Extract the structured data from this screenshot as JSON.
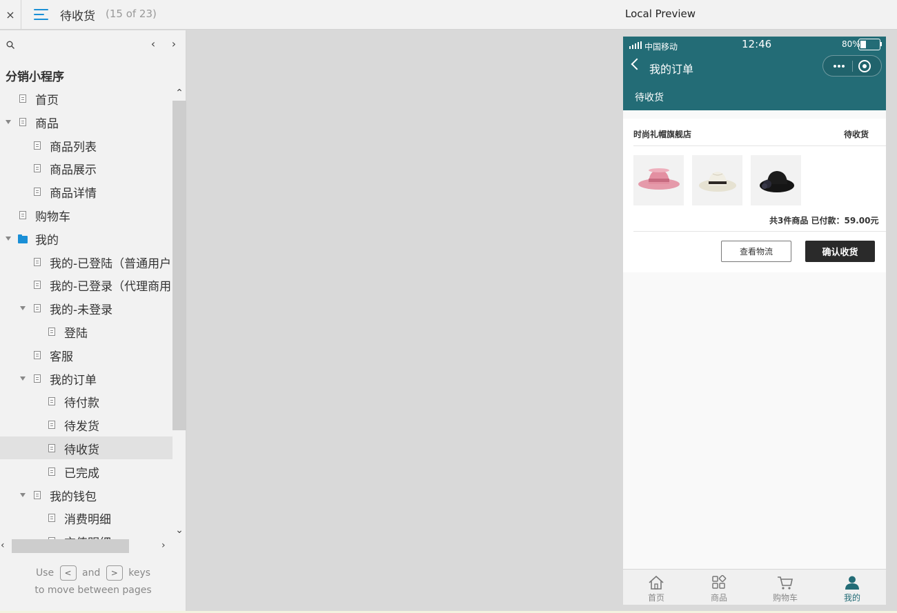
{
  "topbar": {
    "close_icon": "×",
    "page_title": "待收货",
    "page_count": "(15 of 23)",
    "preview_title": "Local Preview"
  },
  "sidebar": {
    "project_title": "分销小程序",
    "tree": [
      {
        "label": "首页",
        "icon": "page",
        "depth": 0
      },
      {
        "label": "商品",
        "icon": "page",
        "depth": 0,
        "expanded": true
      },
      {
        "label": "商品列表",
        "icon": "page",
        "depth": 1
      },
      {
        "label": "商品展示",
        "icon": "page",
        "depth": 1
      },
      {
        "label": "商品详情",
        "icon": "page",
        "depth": 1
      },
      {
        "label": "购物车",
        "icon": "page",
        "depth": 0
      },
      {
        "label": "我的",
        "icon": "folder",
        "depth": 0,
        "expanded": true
      },
      {
        "label": "我的-已登陆（普通用户",
        "icon": "page",
        "depth": 1
      },
      {
        "label": "我的-已登录（代理商用",
        "icon": "page",
        "depth": 1
      },
      {
        "label": "我的-未登录",
        "icon": "page",
        "depth": 1,
        "expanded": true
      },
      {
        "label": "登陆",
        "icon": "page",
        "depth": 2
      },
      {
        "label": "客服",
        "icon": "page",
        "depth": 1
      },
      {
        "label": "我的订单",
        "icon": "page",
        "depth": 1,
        "expanded": true
      },
      {
        "label": "待付款",
        "icon": "page",
        "depth": 2
      },
      {
        "label": "待发货",
        "icon": "page",
        "depth": 2
      },
      {
        "label": "待收货",
        "icon": "page",
        "depth": 2,
        "selected": true
      },
      {
        "label": "已完成",
        "icon": "page",
        "depth": 2
      },
      {
        "label": "我的钱包",
        "icon": "page",
        "depth": 1,
        "expanded": true
      },
      {
        "label": "消费明细",
        "icon": "page",
        "depth": 2
      },
      {
        "label": "充值明细",
        "icon": "page",
        "depth": 2
      }
    ],
    "hint": {
      "use": "Use",
      "and": "and",
      "keys": "keys",
      "line2": "to move between pages",
      "key_prev": "<",
      "key_next": ">"
    }
  },
  "phone": {
    "status": {
      "carrier": "中国移动",
      "time": "12:46",
      "battery": "80%"
    },
    "nav_title": "我的订单",
    "tab_label": "待收货",
    "order": {
      "shop_name": "时尚礼帽旗舰店",
      "status": "待收货",
      "products": [
        {
          "name": "pink-hat",
          "color": "#e59aaa"
        },
        {
          "name": "cream-hat",
          "color": "#ece8d8"
        },
        {
          "name": "black-hat",
          "color": "#151515"
        }
      ],
      "summary": "共3件商品 已付款：59.00元",
      "btn_logistics": "查看物流",
      "btn_confirm": "确认收货"
    },
    "tabbar": [
      {
        "label": "首页",
        "icon": "home-icon"
      },
      {
        "label": "商品",
        "icon": "grid-icon"
      },
      {
        "label": "购物车",
        "icon": "cart-icon"
      },
      {
        "label": "我的",
        "icon": "user-icon",
        "active": true
      }
    ],
    "accent_color": "#236c76"
  }
}
